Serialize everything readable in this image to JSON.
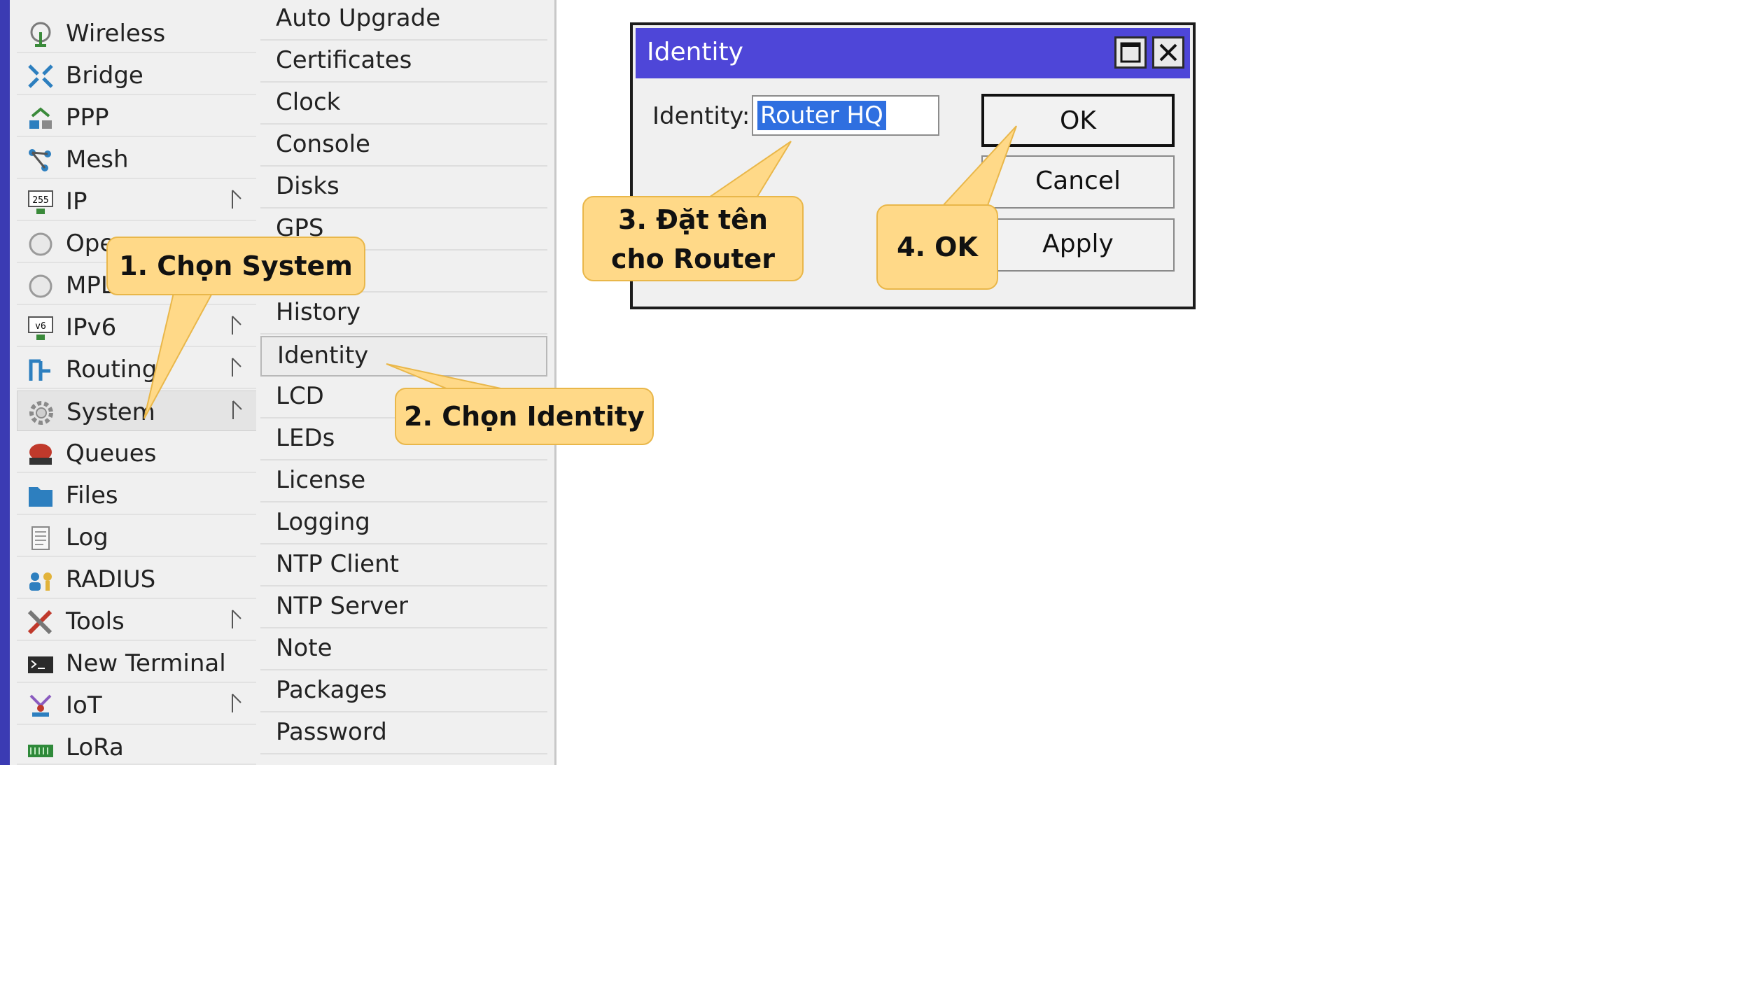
{
  "main_menu": {
    "items": [
      {
        "label": "Wireless",
        "icon": "wireless-icon",
        "submenu": false
      },
      {
        "label": "Bridge",
        "icon": "bridge-icon",
        "submenu": false
      },
      {
        "label": "PPP",
        "icon": "ppp-icon",
        "submenu": false
      },
      {
        "label": "Mesh",
        "icon": "mesh-icon",
        "submenu": false
      },
      {
        "label": "IP",
        "icon": "ip-icon",
        "submenu": true
      },
      {
        "label": "Oper",
        "icon": "openflow-icon",
        "submenu": false
      },
      {
        "label": "MPLS",
        "icon": "mpls-icon",
        "submenu": true
      },
      {
        "label": "IPv6",
        "icon": "ipv6-icon",
        "submenu": true
      },
      {
        "label": "Routing",
        "icon": "routing-icon",
        "submenu": true
      },
      {
        "label": "System",
        "icon": "gear-icon",
        "submenu": true,
        "selected": true
      },
      {
        "label": "Queues",
        "icon": "queues-icon",
        "submenu": false
      },
      {
        "label": "Files",
        "icon": "folder-icon",
        "submenu": false
      },
      {
        "label": "Log",
        "icon": "log-icon",
        "submenu": false
      },
      {
        "label": "RADIUS",
        "icon": "radius-icon",
        "submenu": false
      },
      {
        "label": "Tools",
        "icon": "tools-icon",
        "submenu": true
      },
      {
        "label": "New Terminal",
        "icon": "terminal-icon",
        "submenu": false
      },
      {
        "label": "IoT",
        "icon": "iot-icon",
        "submenu": true
      },
      {
        "label": "LoRa",
        "icon": "lora-icon",
        "submenu": false
      }
    ]
  },
  "system_submenu": {
    "items": [
      {
        "label": "Auto Upgrade"
      },
      {
        "label": "Certificates"
      },
      {
        "label": "Clock"
      },
      {
        "label": "Console"
      },
      {
        "label": "Disks"
      },
      {
        "label": "GPS"
      },
      {
        "label": ""
      },
      {
        "label": "History"
      },
      {
        "label": "Identity",
        "selected": true
      },
      {
        "label": "LCD"
      },
      {
        "label": "LEDs"
      },
      {
        "label": "License"
      },
      {
        "label": "Logging"
      },
      {
        "label": "NTP Client"
      },
      {
        "label": "NTP Server"
      },
      {
        "label": "Note"
      },
      {
        "label": "Packages"
      },
      {
        "label": "Password"
      }
    ]
  },
  "dialog": {
    "title": "Identity",
    "field_label": "Identity:",
    "field_value": "Router HQ",
    "ok_label": "OK",
    "cancel_label": "Cancel",
    "apply_label": "Apply"
  },
  "callouts": {
    "step1": "1. Chọn System",
    "step2": "2. Chọn Identity",
    "step3_line1": "3. Đặt tên",
    "step3_line2": "cho Router",
    "step4": "4. OK"
  },
  "colors": {
    "menu_strip": "#3b3bb3",
    "dialog_titlebar": "#4e46d8",
    "selection": "#2f6fe0",
    "callout_fill": "#ffd988",
    "callout_border": "#e9b74a"
  }
}
